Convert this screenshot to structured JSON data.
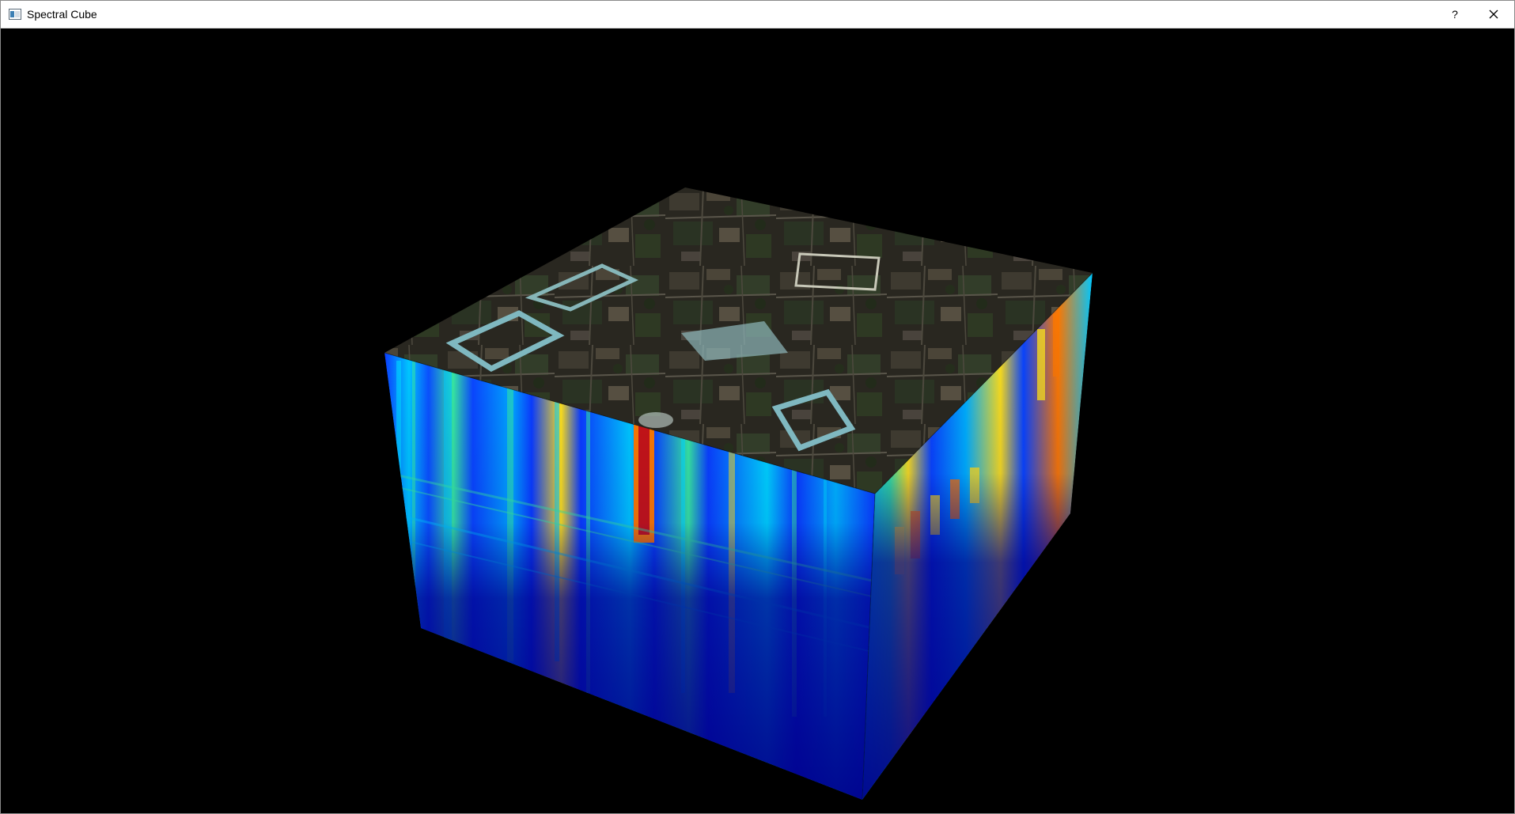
{
  "window": {
    "title": "Spectral Cube",
    "icon": "app-window-icon",
    "controls": {
      "help_label": "?",
      "help_icon": "question-mark-icon",
      "close_icon": "close-icon"
    }
  },
  "viewport": {
    "background": "#000000",
    "scene": "spectral-cube-3d",
    "faces": {
      "top": "aerial-imagery-texture",
      "front": "spectral-heatmap-texture",
      "right": "spectral-heatmap-texture"
    },
    "colormap": [
      "#00008b",
      "#0a3cff",
      "#00c8ff",
      "#37e8a0",
      "#ffe21a",
      "#ff7a00",
      "#c81414"
    ]
  }
}
